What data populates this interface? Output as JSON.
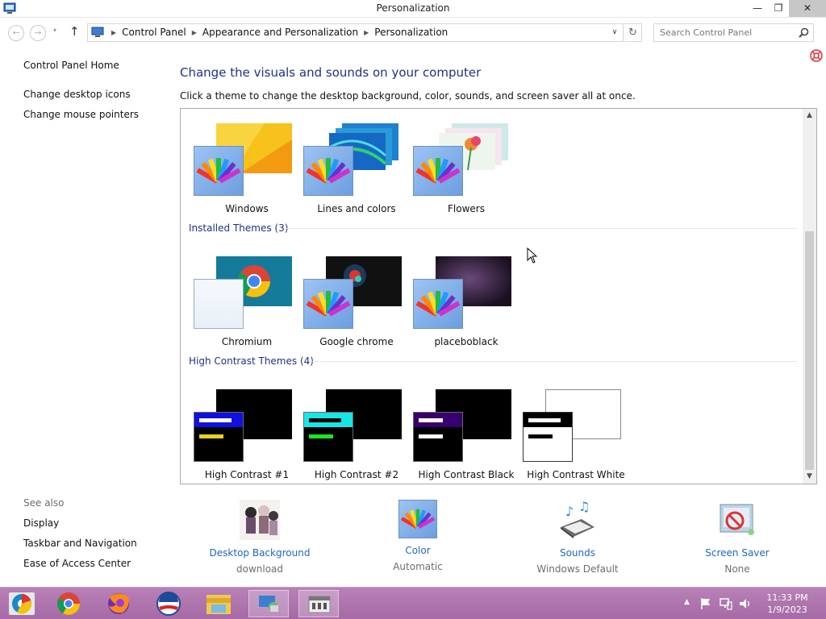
{
  "window": {
    "title": "Personalization",
    "minimize": "—",
    "restore": "❐",
    "close": "✕"
  },
  "nav": {
    "back": "←",
    "forward": "→",
    "recent": "▾",
    "up": "↑",
    "breadcrumbs": [
      "Control Panel",
      "Appearance and Personalization",
      "Personalization"
    ],
    "dropdown": "∨",
    "refresh": "↻",
    "search_placeholder": "Search Control Panel"
  },
  "sidebar": {
    "home": "Control Panel Home",
    "links": [
      "Change desktop icons",
      "Change mouse pointers"
    ],
    "see_also_title": "See also",
    "see_also": [
      "Display",
      "Taskbar and Navigation",
      "Ease of Access Center"
    ]
  },
  "main": {
    "heading": "Change the visuals and sounds on your computer",
    "subheading": "Click a theme to change the desktop background, color, sounds, and screen saver all at once."
  },
  "themes": {
    "default": [
      "Windows",
      "Lines and colors",
      "Flowers"
    ],
    "installed_title": "Installed Themes (3)",
    "installed": [
      "Chromium",
      "Google chrome",
      "placeboblack"
    ],
    "high_contrast_title": "High Contrast Themes (4)",
    "high_contrast": [
      "High Contrast #1",
      "High Contrast #2",
      "High Contrast Black",
      "High Contrast White"
    ]
  },
  "bottom": {
    "desktop_background": {
      "title": "Desktop Background",
      "value": "download"
    },
    "color": {
      "title": "Color",
      "value": "Automatic"
    },
    "sounds": {
      "title": "Sounds",
      "value": "Windows Default"
    },
    "screen_saver": {
      "title": "Screen Saver",
      "value": "None"
    }
  },
  "taskbar": {
    "apps": [
      "chromium-icon",
      "chrome-icon",
      "firefox-icon",
      "obama-logo-icon",
      "file-explorer-icon",
      "control-panel-icon",
      "app-window-icon"
    ],
    "clock_time": "11:33 PM",
    "clock_date": "1/9/2023"
  },
  "colors": {
    "heading_blue": "#1e3287",
    "link_blue": "#1f66c1",
    "taskbar": "#a66aa6"
  }
}
